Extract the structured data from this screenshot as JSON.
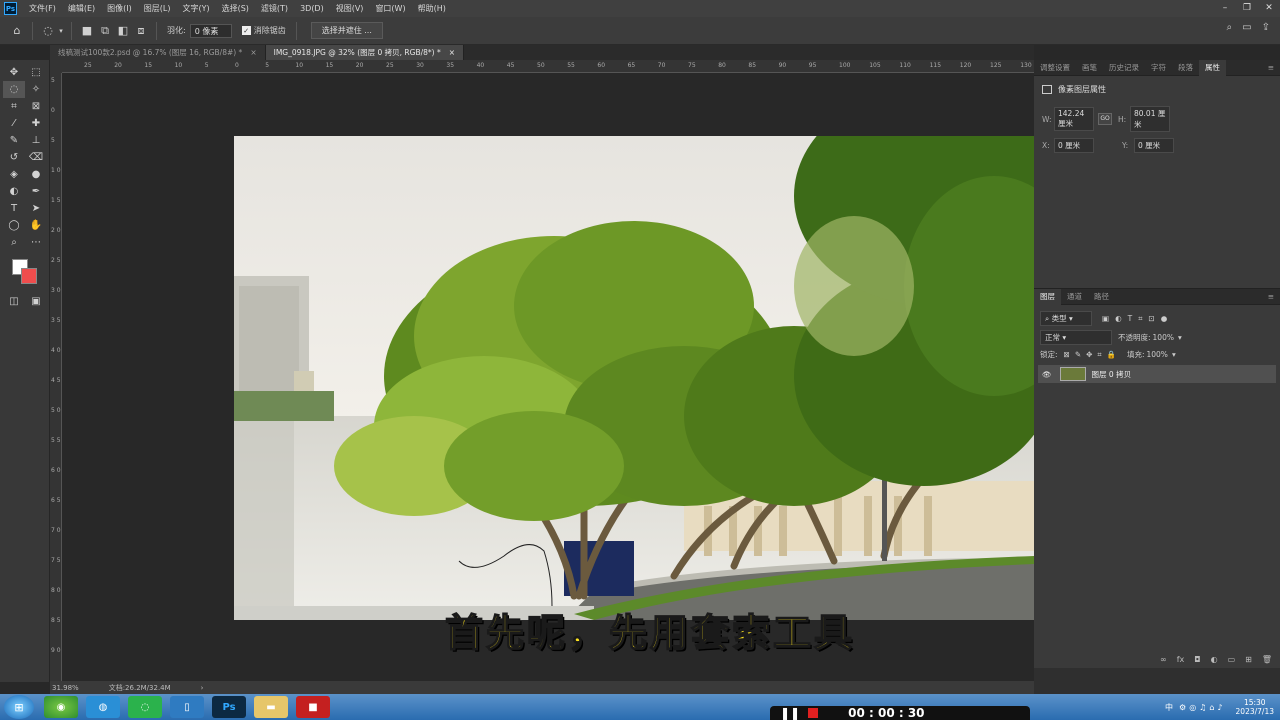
{
  "menubar": {
    "logo": "Ps",
    "items": [
      "文件(F)",
      "编辑(E)",
      "图像(I)",
      "图层(L)",
      "文字(Y)",
      "选择(S)",
      "滤镜(T)",
      "3D(D)",
      "视图(V)",
      "窗口(W)",
      "帮助(H)"
    ],
    "window_controls": [
      "–",
      "❐",
      "✕"
    ]
  },
  "options": {
    "feather_label": "羽化:",
    "feather_value": "0 像素",
    "antialias_label": "消除锯齿",
    "select_mask_button": "选择并遮住 ..."
  },
  "tabs": [
    {
      "label": "线稿测试100款2.psd @ 16.7% (图层 16, RGB/8#) *",
      "close": "×"
    },
    {
      "label": "IMG_0918.JPG @ 32% (图层 0 拷贝, RGB/8*) *",
      "close": "×"
    }
  ],
  "ruler": {
    "top": [
      "25",
      "20",
      "15",
      "10",
      "5",
      "0",
      "5",
      "10",
      "15",
      "20",
      "25",
      "30",
      "35",
      "40",
      "45",
      "50",
      "55",
      "60",
      "65",
      "70",
      "75",
      "80",
      "85",
      "90",
      "95",
      "100",
      "105",
      "110",
      "115",
      "120",
      "125",
      "130",
      "135",
      "140",
      "145"
    ],
    "left": [
      "5",
      "0",
      "5",
      "1 0",
      "1 5",
      "2 0",
      "2 5",
      "3 0",
      "3 5",
      "4 0",
      "4 5",
      "5 0",
      "5 5",
      "6 0",
      "6 5",
      "7 0",
      "7 5",
      "8 0",
      "8 5",
      "9 0"
    ]
  },
  "subtitle": "首先呢，先用套索工具",
  "status": {
    "zoom": "31.98%",
    "doc": "文档:26.2M/32.4M"
  },
  "panel_tabs_top": [
    "调整设置",
    "画笔",
    "历史记录",
    "字符",
    "段落",
    "属性"
  ],
  "properties": {
    "title": "像素图层属性",
    "w_label": "W:",
    "w_value": "142.24 厘米",
    "link_label": "GO",
    "h_label": "H:",
    "h_value": "80.01 厘米",
    "x_label": "X:",
    "x_value": "0 厘米",
    "y_label": "Y:",
    "y_value": "0 厘米"
  },
  "layers": {
    "tabs": [
      "图层",
      "通道",
      "路径"
    ],
    "filter_label": "类型",
    "blend_mode": "正常",
    "opacity_label": "不透明度:",
    "opacity_value": "100%",
    "lock_label": "锁定:",
    "fill_label": "填充:",
    "fill_value": "100%",
    "items": [
      {
        "name": "图层 0 拷贝",
        "visible": true
      }
    ]
  },
  "taskbar": {
    "apps": [
      "chrome",
      "qq",
      "wechat",
      "tablet",
      "Ps",
      "folder",
      "recorder"
    ],
    "time": "15:30",
    "date": "2023/7/13",
    "ime": "中"
  },
  "recorder": {
    "time": "00 : 00 : 30"
  }
}
